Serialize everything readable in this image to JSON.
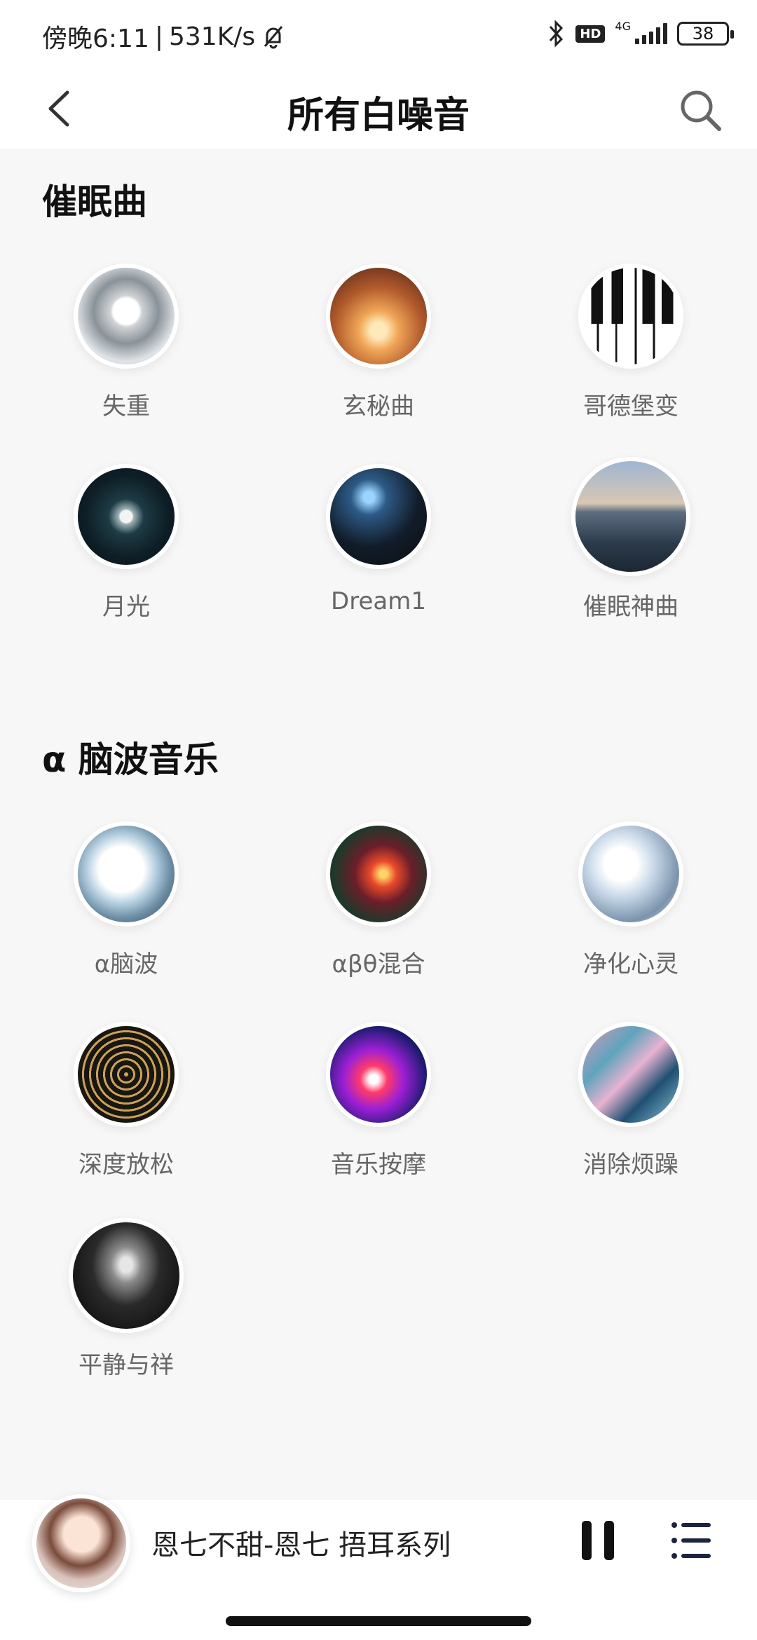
{
  "status_bar": {
    "time": "傍晚6:11",
    "network_speed": "531K/s",
    "network_type": "4G",
    "hd_badge": "HD",
    "battery": "38"
  },
  "header": {
    "title": "所有白噪音",
    "back_icon": "chevron-left-icon",
    "search_icon": "search-icon"
  },
  "sections": [
    {
      "title": "催眠曲",
      "items": [
        {
          "label": "失重"
        },
        {
          "label": "玄秘曲"
        },
        {
          "label": "哥德堡变"
        },
        {
          "label": "月光"
        },
        {
          "label": "Dream1"
        },
        {
          "label": "催眠神曲"
        }
      ]
    },
    {
      "title": "α 脑波音乐",
      "items": [
        {
          "label": "α脑波"
        },
        {
          "label": "αβθ混合"
        },
        {
          "label": "净化心灵"
        },
        {
          "label": "深度放松"
        },
        {
          "label": "音乐按摩"
        },
        {
          "label": "消除烦躁"
        },
        {
          "label": "平静与祥"
        }
      ]
    }
  ],
  "player": {
    "title": "恩七不甜-恩七 捂耳系列",
    "pause_icon": "pause-icon",
    "playlist_icon": "playlist-icon"
  },
  "colors": {
    "background": "#f7f7f7",
    "label": "#666666",
    "title": "#111111"
  }
}
